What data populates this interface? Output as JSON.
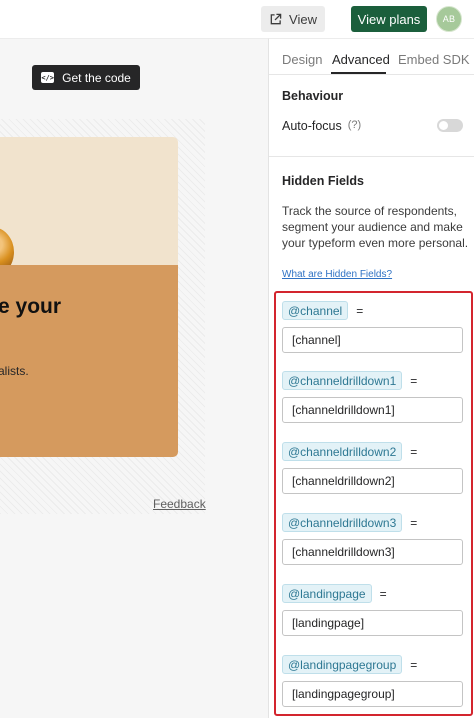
{
  "header": {
    "view_label": "View",
    "view_plans_label": "View plans",
    "avatar_initials": "AB",
    "brand_color": "#1b5f3c"
  },
  "preview": {
    "get_code_label": "Get the code",
    "card_heading": "e your",
    "card_subtext": "alists.",
    "feedback_label": "Feedback"
  },
  "panel": {
    "tabs": [
      {
        "label": "Design",
        "active": false
      },
      {
        "label": "Advanced",
        "active": true
      },
      {
        "label": "Embed SDK",
        "active": false
      }
    ],
    "behaviour": {
      "title": "Behaviour",
      "autofocus_label": "Auto-focus",
      "help": "(?)",
      "autofocus_on": false
    },
    "hidden_fields": {
      "title": "Hidden Fields",
      "description": "Track the source of respondents, segment your audience and make your typeform even more personal.",
      "help_link": "What are Hidden Fields?",
      "highlight_color": "#d3252e",
      "fields": [
        {
          "tag": "@channel",
          "eq": "=",
          "value": "[channel]"
        },
        {
          "tag": "@channeldrilldown1",
          "eq": "=",
          "value": "[channeldrilldown1]"
        },
        {
          "tag": "@channeldrilldown2",
          "eq": "=",
          "value": "[channeldrilldown2]"
        },
        {
          "tag": "@channeldrilldown3",
          "eq": "=",
          "value": "[channeldrilldown3]"
        },
        {
          "tag": "@landingpage",
          "eq": "=",
          "value": "[landingpage]"
        },
        {
          "tag": "@landingpagegroup",
          "eq": "=",
          "value": "[landingpagegroup]"
        }
      ]
    }
  }
}
